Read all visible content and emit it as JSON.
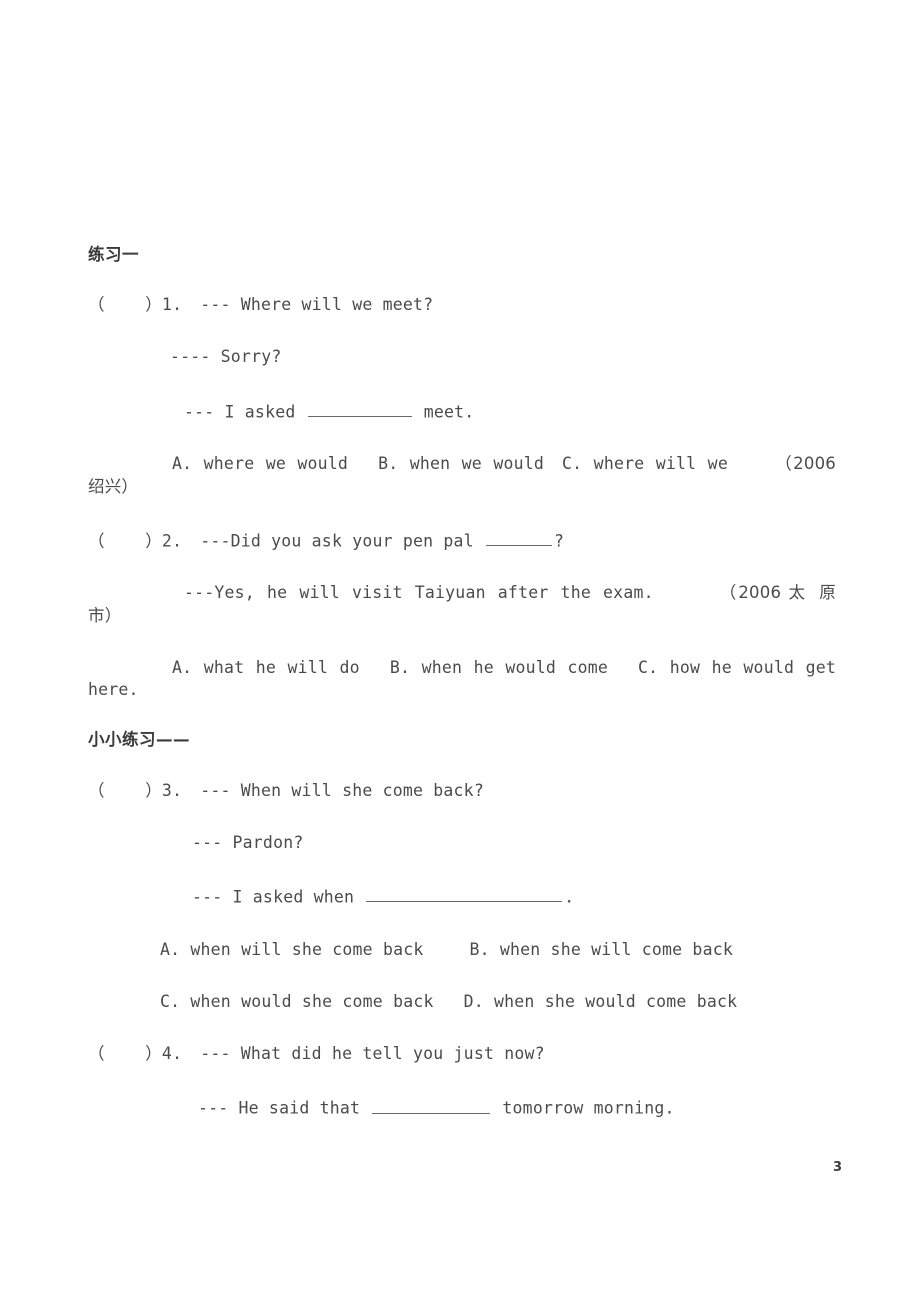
{
  "document": {
    "page_number": "3",
    "text_color": "#4d4a4a",
    "background_color": "#ffffff"
  },
  "sections": [
    {
      "heading": "练习一",
      "questions": [
        {
          "marker": "（    ）1.",
          "lines": [
            "--- Where will we meet?",
            "---- Sorry?",
            "--- I asked ________ meet."
          ],
          "options_line": "A. where we would     B. when we would    C. where will we     （2006 绍兴）",
          "option_a": "A. where we would",
          "option_b": "B. when we would",
          "option_c": "C. where will we",
          "source": "（2006",
          "source_cont": "绍兴）"
        },
        {
          "marker": "（    ）2.",
          "lines": [
            "---Did you ask your pen pal ______?",
            "---Yes, he will visit Taiyuan after the exam."
          ],
          "option_a": "A. what he will do",
          "option_b": "B. when he would come",
          "option_c": "C. how he would",
          "option_c_cont": "get here.",
          "source": "（2006 太",
          "source_cont": "原市）"
        }
      ]
    },
    {
      "heading": "小小练习——",
      "questions": [
        {
          "marker": "（    ）3.",
          "lines": [
            "--- When will she come back?",
            "--- Pardon?",
            "--- I asked when __________________."
          ],
          "option_a": "A. when will she come back",
          "option_b": "B. when she will come back",
          "option_c": "C. when would she come back",
          "option_d": "D. when she would come back"
        },
        {
          "marker": "（    ）4.",
          "lines": [
            "--- What did he tell you just now?",
            "--- He said that ___________ tomorrow morning."
          ]
        }
      ]
    }
  ],
  "q1": {
    "marker": "（    ）1.",
    "line1": "--- Where will we meet?",
    "line2": "---- Sorry?",
    "line3_a": "--- I asked ",
    "line3_b": " meet.",
    "opt_a": "A. where we would",
    "opt_b": "B. when we would",
    "opt_c": "C. where will we",
    "src": "（2006",
    "src2": "绍兴）"
  },
  "q2": {
    "marker": "（    ）2.",
    "line1_a": "---Did you ask your pen pal ",
    "line1_b": "?",
    "line2": "---Yes, he will visit Taiyuan after the exam.",
    "src": "（2006 太",
    "src2": "原市）",
    "opt_a": "A. what he will do",
    "opt_b": "B. when he would come",
    "opt_c": "C. how he would",
    "opt_c2": "get here."
  },
  "q3": {
    "marker": "（    ）3.",
    "line1": "--- When will she come back?",
    "line2": "--- Pardon?",
    "line3_a": "--- I asked when ",
    "line3_b": ".",
    "opt_a": "A. when will she come back",
    "opt_b": "B. when she will come back",
    "opt_c": "C. when would she come back",
    "opt_d": "D. when she would come back"
  },
  "q4": {
    "marker": "（    ）4.",
    "line1": "--- What did he tell you just now?",
    "line2_a": "--- He said that ",
    "line2_b": " tomorrow morning."
  },
  "headings": {
    "section1": "练习一",
    "section2": "小小练习——"
  },
  "footer": {
    "page_number": "3"
  }
}
